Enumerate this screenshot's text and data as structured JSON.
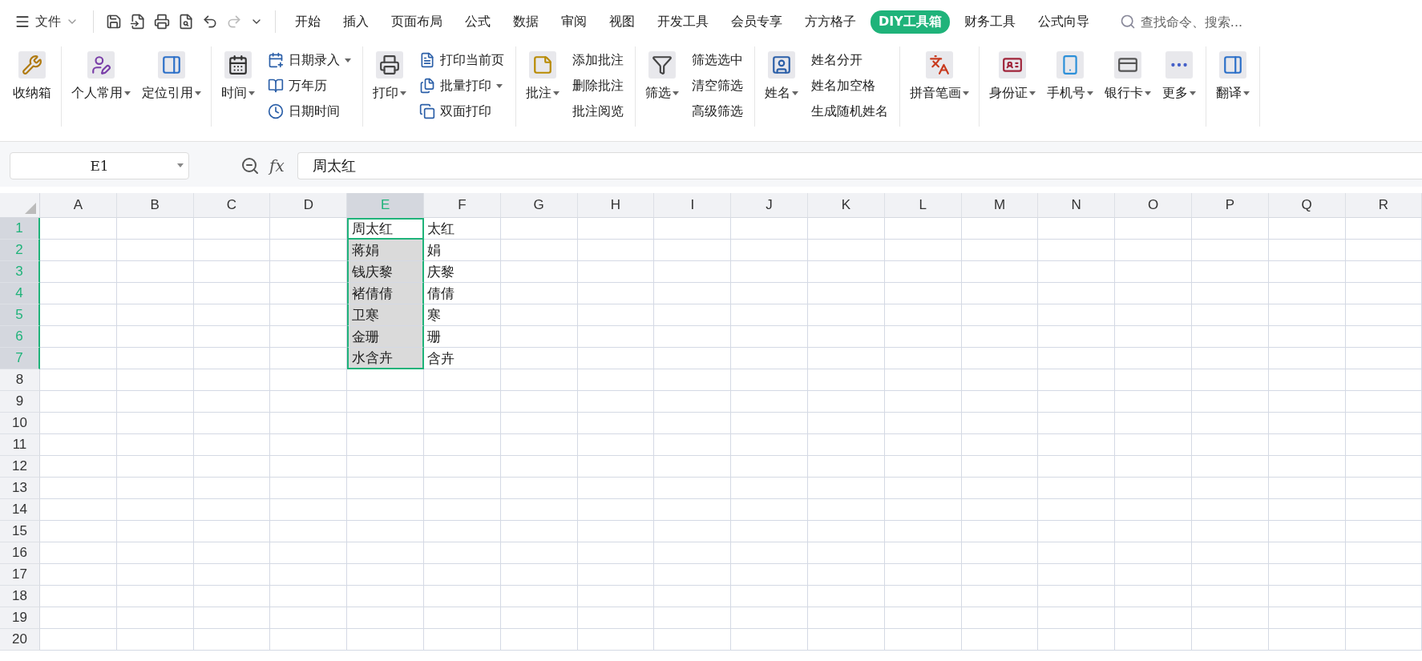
{
  "menu": {
    "file_label": "文件",
    "tabs": [
      {
        "label": "开始",
        "selected": false
      },
      {
        "label": "插入",
        "selected": false
      },
      {
        "label": "页面布局",
        "selected": false
      },
      {
        "label": "公式",
        "selected": false
      },
      {
        "label": "数据",
        "selected": false
      },
      {
        "label": "审阅",
        "selected": false
      },
      {
        "label": "视图",
        "selected": false
      },
      {
        "label": "开发工具",
        "selected": false
      },
      {
        "label": "会员专享",
        "selected": false
      },
      {
        "label": "方方格子",
        "selected": false
      },
      {
        "label": "DIY工具箱",
        "selected": true
      },
      {
        "label": "财务工具",
        "selected": false
      },
      {
        "label": "公式向导",
        "selected": false
      }
    ],
    "search": {
      "placeholder": "查找命令、搜索..."
    }
  },
  "ribbon": {
    "groups": [
      {
        "items": [
          {
            "kind": "large",
            "label": "收纳箱",
            "dropdown": false
          }
        ]
      },
      {
        "items": [
          {
            "kind": "large",
            "label": "个人常用",
            "dropdown": true
          },
          {
            "kind": "large",
            "label": "定位引用",
            "dropdown": true
          }
        ]
      },
      {
        "items": [
          {
            "kind": "large",
            "label": "时间",
            "dropdown": true
          },
          {
            "kind": "stack",
            "icons": true,
            "entries": [
              {
                "label": "日期录入",
                "dropdown": true
              },
              {
                "label": "万年历",
                "dropdown": false
              },
              {
                "label": "日期时间",
                "dropdown": false
              }
            ]
          }
        ]
      },
      {
        "items": [
          {
            "kind": "large",
            "label": "打印",
            "dropdown": true
          },
          {
            "kind": "stack",
            "icons": true,
            "entries": [
              {
                "label": "打印当前页",
                "dropdown": false
              },
              {
                "label": "批量打印",
                "dropdown": true
              },
              {
                "label": "双面打印",
                "dropdown": false
              }
            ]
          }
        ]
      },
      {
        "items": [
          {
            "kind": "large",
            "label": "批注",
            "dropdown": true
          },
          {
            "kind": "stack",
            "icons": false,
            "entries": [
              {
                "label": "添加批注",
                "dropdown": false
              },
              {
                "label": "删除批注",
                "dropdown": false
              },
              {
                "label": "批注阅览",
                "dropdown": false
              }
            ]
          }
        ]
      },
      {
        "items": [
          {
            "kind": "large",
            "label": "筛选",
            "dropdown": true
          },
          {
            "kind": "stack",
            "icons": false,
            "entries": [
              {
                "label": "筛选选中",
                "dropdown": false
              },
              {
                "label": "清空筛选",
                "dropdown": false
              },
              {
                "label": "高级筛选",
                "dropdown": false
              }
            ]
          }
        ]
      },
      {
        "items": [
          {
            "kind": "large",
            "label": "姓名",
            "dropdown": true
          },
          {
            "kind": "stack",
            "icons": false,
            "entries": [
              {
                "label": "姓名分开",
                "dropdown": false
              },
              {
                "label": "姓名加空格",
                "dropdown": false
              },
              {
                "label": "生成随机姓名",
                "dropdown": false
              }
            ]
          }
        ]
      },
      {
        "items": [
          {
            "kind": "large",
            "label": "拼音笔画",
            "dropdown": true
          }
        ]
      },
      {
        "items": [
          {
            "kind": "large",
            "label": "身份证",
            "dropdown": true
          },
          {
            "kind": "large",
            "label": "手机号",
            "dropdown": true
          },
          {
            "kind": "large",
            "label": "银行卡",
            "dropdown": true
          },
          {
            "kind": "large",
            "label": "更多",
            "dropdown": true
          }
        ]
      },
      {
        "items": [
          {
            "kind": "large",
            "label": "翻译",
            "dropdown": true
          }
        ]
      }
    ]
  },
  "formula_bar": {
    "name_box": "E1",
    "fx_label": "fx",
    "value": "周太红"
  },
  "sheet": {
    "columns": [
      {
        "label": "A",
        "selected": false
      },
      {
        "label": "B",
        "selected": false
      },
      {
        "label": "C",
        "selected": false
      },
      {
        "label": "D",
        "selected": false
      },
      {
        "label": "E",
        "selected": true
      },
      {
        "label": "F",
        "selected": false
      },
      {
        "label": "G",
        "selected": false
      },
      {
        "label": "H",
        "selected": false
      },
      {
        "label": "I",
        "selected": false
      },
      {
        "label": "J",
        "selected": false
      },
      {
        "label": "K",
        "selected": false
      },
      {
        "label": "L",
        "selected": false
      },
      {
        "label": "M",
        "selected": false
      },
      {
        "label": "N",
        "selected": false
      },
      {
        "label": "O",
        "selected": false
      },
      {
        "label": "P",
        "selected": false
      },
      {
        "label": "Q",
        "selected": false
      },
      {
        "label": "R",
        "selected": false
      }
    ],
    "rows": [
      {
        "label": "1",
        "selected": true,
        "active": true,
        "column_e": "周太红",
        "column_f": "太红"
      },
      {
        "label": "2",
        "selected": true,
        "active": false,
        "column_e": "蒋娟",
        "column_f": "娟"
      },
      {
        "label": "3",
        "selected": true,
        "active": false,
        "column_e": "钱庆黎",
        "column_f": "庆黎"
      },
      {
        "label": "4",
        "selected": true,
        "active": false,
        "column_e": "褚倩倩",
        "column_f": "倩倩"
      },
      {
        "label": "5",
        "selected": true,
        "active": false,
        "column_e": "卫寒",
        "column_f": "寒"
      },
      {
        "label": "6",
        "selected": true,
        "active": false,
        "column_e": "金珊",
        "column_f": "珊"
      },
      {
        "label": "7",
        "selected": true,
        "active": false,
        "column_e": "水含卉",
        "column_f": "含卉"
      },
      {
        "label": "8",
        "selected": false,
        "active": false
      },
      {
        "label": "9",
        "selected": false,
        "active": false
      },
      {
        "label": "10",
        "selected": false,
        "active": false
      },
      {
        "label": "11",
        "selected": false,
        "active": false
      },
      {
        "label": "12",
        "selected": false,
        "active": false
      },
      {
        "label": "13",
        "selected": false,
        "active": false
      },
      {
        "label": "14",
        "selected": false,
        "active": false
      },
      {
        "label": "15",
        "selected": false,
        "active": false
      },
      {
        "label": "16",
        "selected": false,
        "active": false
      },
      {
        "label": "17",
        "selected": false,
        "active": false
      },
      {
        "label": "18",
        "selected": false,
        "active": false
      },
      {
        "label": "19",
        "selected": false,
        "active": false
      },
      {
        "label": "20",
        "selected": false,
        "active": false
      }
    ]
  }
}
